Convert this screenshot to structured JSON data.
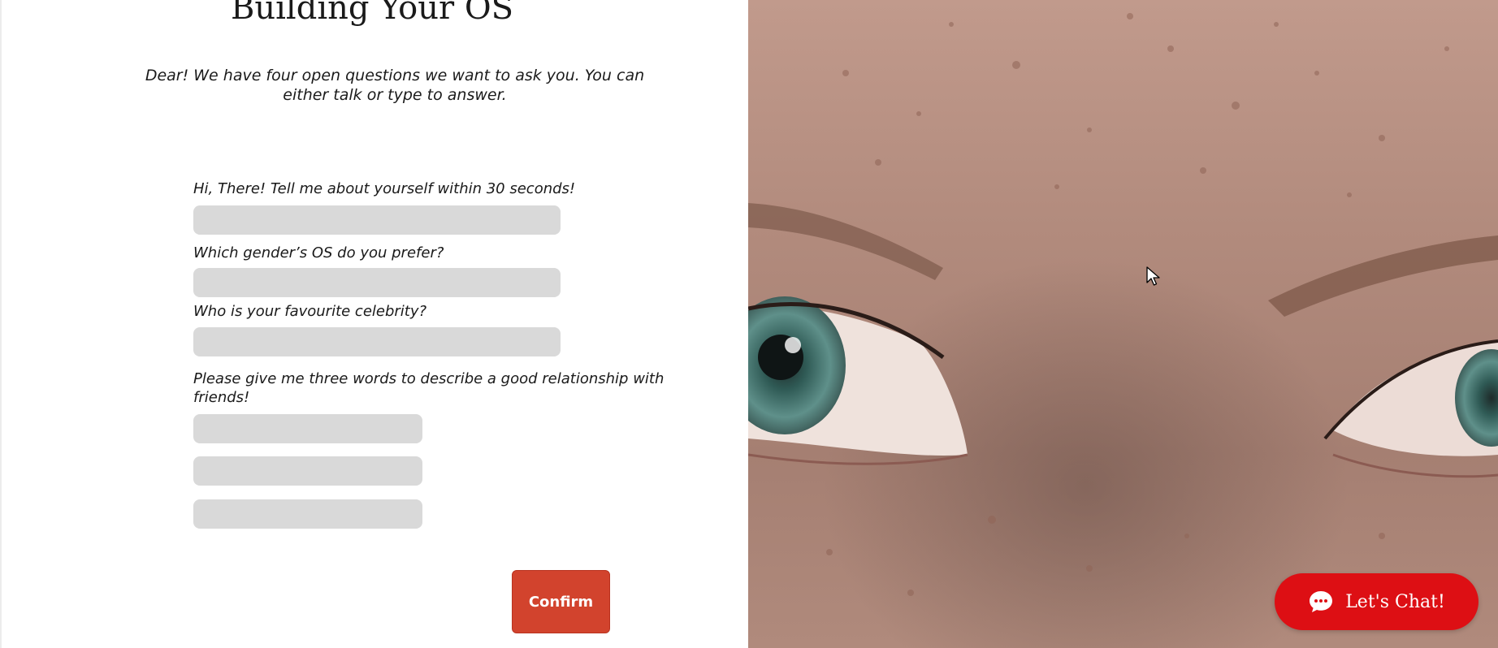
{
  "form": {
    "title": "Building Your OS",
    "intro": "Dear! We have four open questions we want to ask you. You can either talk or type to answer.",
    "questions": [
      {
        "label": "Hi, There! Tell me about yourself within 30 seconds!",
        "value": ""
      },
      {
        "label": "Which gender’s OS do you prefer?",
        "value": ""
      },
      {
        "label": "Who is your favourite celebrity?",
        "value": ""
      },
      {
        "label": "Please give me three words to describe a good relationship with friends!",
        "values": [
          "",
          "",
          ""
        ]
      }
    ],
    "confirm_label": "Confirm"
  },
  "hero_image": {
    "icon": "close-up-eyes-photo"
  },
  "chat": {
    "label": "Let's Chat!",
    "icon": "chat-bubble-icon",
    "color": "#dd0f14"
  },
  "colors": {
    "confirm": "#d2432d",
    "input_bg": "#d9d9d9"
  }
}
